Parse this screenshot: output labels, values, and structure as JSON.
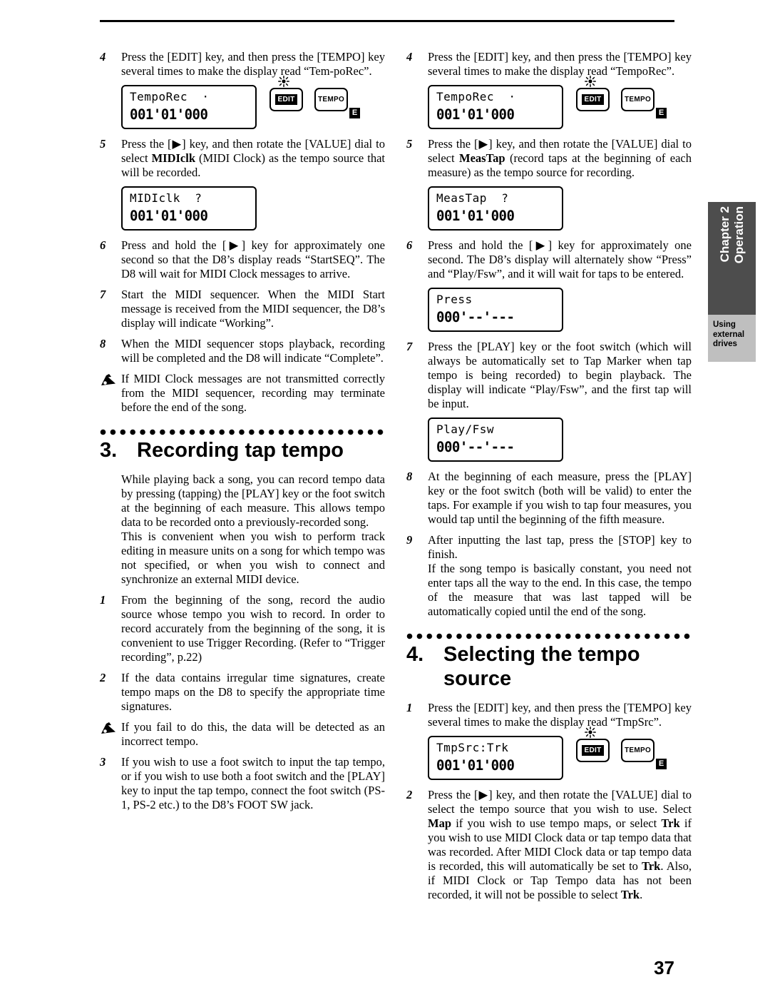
{
  "page": {
    "number": "37"
  },
  "side_tab": {
    "chapter_line1": "Chapter 2",
    "chapter_line2": "Operation",
    "sub_line1": "Using",
    "sub_line2": "external",
    "sub_line3": "drives",
    "dark_color": "#4d4d4d",
    "light_color": "#bfbfbf"
  },
  "left_column": {
    "step4": {
      "num": "4",
      "text": "Press the [EDIT] key, and then press the [TEMPO] key several times to make the display read “Tem-poRec”."
    },
    "lcd4": {
      "line1": "TempoRec  ·",
      "line2": "001'01'000",
      "edit_label": "EDIT",
      "tempo_label": "TEMPO",
      "e_badge": "E"
    },
    "step5": {
      "num": "5",
      "text_a": "Press the [▶] key, and then rotate the [VALUE] dial to select ",
      "bold": "MIDIclk",
      "text_b": " (MIDI Clock) as the tempo source that will be recorded."
    },
    "lcd5": {
      "line1": "MIDIclk  ?",
      "line2": "001'01'000"
    },
    "step6": {
      "num": "6",
      "text": "Press and hold the [▶] key for approximately one second so that the D8’s display reads “StartSEQ”. The D8 will wait for MIDI Clock messages to arrive."
    },
    "step7": {
      "num": "7",
      "text": "Start the MIDI sequencer. When the MIDI Start message is received from the MIDI sequencer, the D8’s display will indicate “Working”."
    },
    "step8": {
      "num": "8",
      "text": "When the MIDI sequencer stops playback, recording will be completed and the D8 will indicate “Complete”."
    },
    "note1": {
      "text": "If MIDI Clock messages are not transmitted correctly from the MIDI sequencer, recording may terminate before the end of the song."
    },
    "section3": {
      "num": "3.",
      "title": "Recording tap tempo",
      "intro_p1": "While playing back a song, you can record tempo data by pressing (tapping) the [PLAY] key or the foot switch at the beginning of each measure. This allows tempo data to be recorded onto a previously-recorded song.",
      "intro_p2": "This is convenient when you wish to perform track editing in measure units on a song for which tempo was not specified, or when you wish to connect and synchronize an external MIDI device."
    },
    "step3_1": {
      "num": "1",
      "text": "From the beginning of the song, record the audio source whose tempo you wish to record. In order to record accurately from the beginning of the song, it is convenient to use Trigger Recording. (Refer to “Trigger recording”, p.22)"
    },
    "step3_2": {
      "num": "2",
      "text": "If the data contains irregular time signatures, create tempo maps on the D8 to specify the appropriate time signatures."
    },
    "note2": {
      "text": "If you fail to do this, the data will be detected as an incorrect tempo."
    },
    "step3_3": {
      "num": "3",
      "text": "If you wish to use a foot switch to input the tap tempo, or if you wish to use both a foot switch and the [PLAY] key to input the tap tempo, connect the foot switch (PS-1, PS-2 etc.) to the D8’s FOOT SW jack."
    }
  },
  "right_column": {
    "step4": {
      "num": "4",
      "text": "Press the [EDIT] key, and then press the [TEMPO] key several times to make the display read “TempoRec”."
    },
    "lcd4": {
      "line1": "TempoRec  ·",
      "line2": "001'01'000",
      "edit_label": "EDIT",
      "tempo_label": "TEMPO",
      "e_badge": "E"
    },
    "step5": {
      "num": "5",
      "text_a": "Press the [▶] key, and then rotate the [VALUE] dial to select ",
      "bold": "MeasTap",
      "text_b": " (record taps at the beginning of each measure) as the tempo source for recording."
    },
    "lcd5": {
      "line1": "MeasTap  ?",
      "line2": "001'01'000"
    },
    "step6": {
      "num": "6",
      "text": "Press and hold the [▶] key for approximately one second. The D8’s display will alternately show “Press” and “Play/Fsw”, and it will wait for taps to be entered."
    },
    "lcd6": {
      "line1": "Press",
      "line2": "000'--'---"
    },
    "step7": {
      "num": "7",
      "text": "Press the [PLAY] key or the foot switch (which will always be automatically set to Tap Marker when tap tempo is being recorded) to begin playback. The display will indicate “Play/Fsw”, and the first tap will be input."
    },
    "lcd7": {
      "line1": "Play/Fsw",
      "line2": "000'--'---"
    },
    "step8": {
      "num": "8",
      "text": "At the beginning of each measure, press the [PLAY] key or the foot switch (both will be valid) to enter the taps. For example if you wish to tap four measures, you would tap until the beginning of the fifth measure."
    },
    "step9": {
      "num": "9",
      "text": "After inputting the last tap, press the [STOP] key to finish.",
      "text2": "If the song tempo is basically constant, you need not enter taps all the way to the end. In this case, the tempo of the measure that was last tapped will be automatically copied until the end of the song."
    },
    "section4": {
      "num": "4.",
      "title": "Selecting the tempo source"
    },
    "step4_1": {
      "num": "1",
      "text": "Press the [EDIT] key, and then press the [TEMPO] key several times to make the display read “TmpSrc”."
    },
    "lcd4_1": {
      "line1": "TmpSrc:Trk",
      "line2": "001'01'000",
      "edit_label": "EDIT",
      "tempo_label": "TEMPO",
      "e_badge": "E"
    },
    "step4_2": {
      "num": "2",
      "t1": "Press the [▶] key, and then rotate the [VALUE] dial to select the tempo source that you wish to use. Select ",
      "b1": "Map",
      "t2": " if you wish to use tempo maps, or select ",
      "b2": "Trk",
      "t3": " if you wish to use MIDI Clock data or tap tempo data that was recorded. After MIDI Clock data or tap tempo data is recorded, this will automatically be set to ",
      "b3": "Trk",
      "t4": ". Also, if MIDI Clock or Tap Tempo data has not been recorded, it will not be possible to select ",
      "b4": "Trk",
      "t5": "."
    }
  }
}
